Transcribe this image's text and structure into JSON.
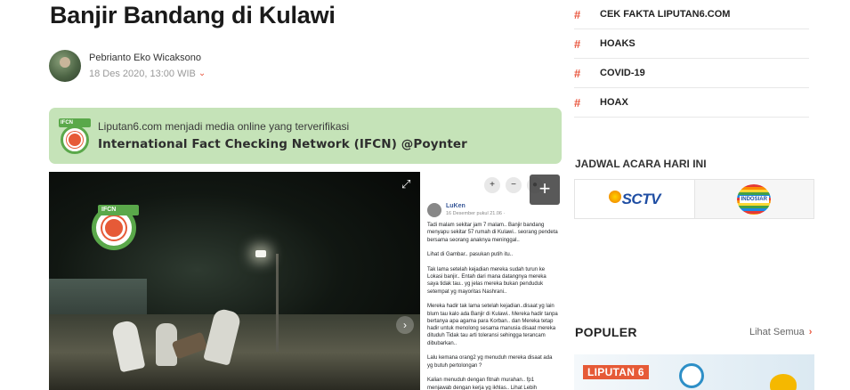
{
  "article": {
    "title": "Banjir Bandang di Kulawi",
    "author": "Pebrianto Eko Wicaksono",
    "date": "18 Des 2020, 13:00 WIB"
  },
  "banner": {
    "line1": "Liputan6.com menjadi media online yang terverifikasi",
    "line2": "International Fact Checking Network (IFCN) @Poynter"
  },
  "media": {
    "fb_name": "LuKen",
    "fb_date": "16 Desember pukul 21.06 · ",
    "fb_text": "Tadi malam sekitar jam 7 malam.. Banjir bandang menyapu sekitar 57 rumah di Kulawi.. seorang pendeta bersama seorang anaknya meninggal..\n\nLihat di Gambar.. pasukan putih itu..\n\nTak lama setelah kejadian mereka sudah turun ke Lokasi banjir.. Entah dari mana datangnya mereka saya tidak tau.. yg jelas mereka bukan penduduk setempat yg mayoritas Nashrani..\n\nMereka hadir tak lama setelah kejadian..disaat yg lain blum tau kalo ada Banjir di Kulawi.. Mereka hadir tanpa bertanya apa agama para Korban.. dan Mereka tetap hadir untuk menolong sesama manusia disaat mereka dituduh Tidak tau arti toleransi sehingga terancam dibubarkan..\n\nLalu kemana orang2 yg menuduh mereka disaat ada yg butuh pertolongan ?\n\nKalian menuduh dengan fitnah murahan.. fp1 menjawab dengan kerja yg ikhlas.. Lihat Lebih"
  },
  "sidebar": {
    "topics": [
      {
        "label": "CEK FAKTA LIPUTAN6.COM"
      },
      {
        "label": "HOAKS"
      },
      {
        "label": "COVID-19"
      },
      {
        "label": "HOAX"
      }
    ],
    "schedule_title": "JADWAL ACARA HARI INI",
    "channels": [
      "SCTV",
      "INDOSIAR"
    ],
    "popular_title": "POPULER",
    "see_all": "Lihat Semua",
    "popular_card_brand": "LIPUTAN 6"
  },
  "colors": {
    "accent": "#e9573f",
    "banner_bg": "#c5e3b8",
    "ifcn_green": "#5aa84a"
  },
  "icons": [
    "chevron-down-icon",
    "expand-icon",
    "add-icon",
    "next-arrow-icon",
    "hash-icon",
    "chevron-right-icon"
  ]
}
